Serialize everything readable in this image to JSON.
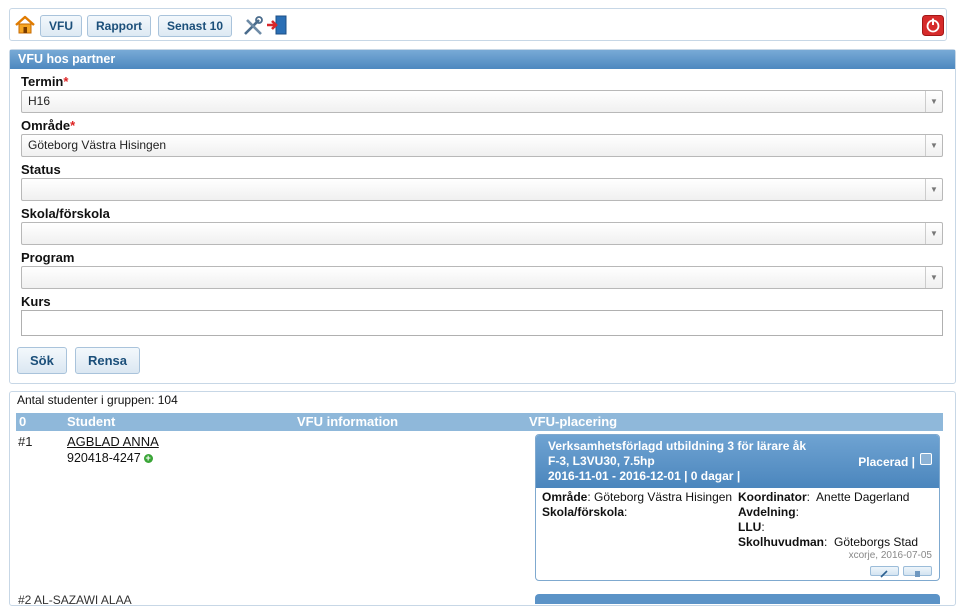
{
  "toolbar": {
    "vfu": "VFU",
    "rapport": "Rapport",
    "senast": "Senast 10"
  },
  "search": {
    "title": "VFU hos partner",
    "termin_label": "Termin",
    "termin_value": "H16",
    "omrade_label": "Område",
    "omrade_value": "Göteborg Västra Hisingen",
    "status_label": "Status",
    "status_value": "",
    "skola_label": "Skola/förskola",
    "skola_value": "",
    "program_label": "Program",
    "program_value": "",
    "kurs_label": "Kurs",
    "kurs_value": "",
    "required_mark": "*",
    "search_button": "Sök",
    "reset_button": "Rensa"
  },
  "results": {
    "count_text": "Antal studenter i gruppen: 104",
    "columns": [
      "0",
      "Student",
      "VFU information",
      "VFU-placering"
    ],
    "rows": [
      {
        "num": "#1",
        "name": "AGBLAD ANNA",
        "pnr": "920418-4247",
        "placement": {
          "title_line1": "Verksamhetsförlagd utbildning 3 för lärare åk",
          "title_line2": "F-3, L3VU30, 7.5hp",
          "dates": "2016-11-01 - 2016-12-01 | 0 dagar |",
          "status": "Placerad |",
          "omrade_label": "Område",
          "omrade_value": "Göteborg Västra Hisingen",
          "skola_label": "Skola/förskola",
          "skola_value": "",
          "koordinator_label": "Koordinator",
          "koordinator_value": "Anette Dagerland",
          "avdelning_label": "Avdelning",
          "avdelning_value": "",
          "llu_label": "LLU",
          "llu_value": "",
          "huvudman_label": "Skolhuvudman",
          "huvudman_value": "Göteborgs Stad",
          "meta": "xcorje, 2016-07-05"
        }
      }
    ],
    "next_row_partial": "#2     AL-SAZAWI ALAA"
  },
  "icons": {
    "home": "home-icon",
    "tools": "tools-icon",
    "exit": "exit-icon",
    "power": "power-icon",
    "add": "plus-circle-icon",
    "settings": "gear-icon",
    "edit": "edit-icon",
    "more": "more-icon"
  },
  "colors": {
    "header_blue": "#4d88bf",
    "table_head": "#8fb8da",
    "power_red": "#d62b2b",
    "add_green": "#3aa537"
  }
}
